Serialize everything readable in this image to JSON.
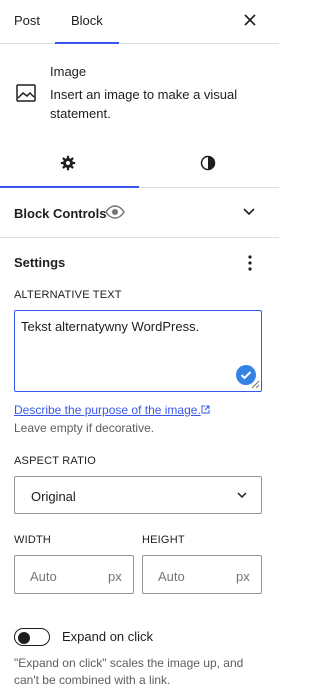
{
  "tabs": {
    "post_label": "Post",
    "block_label": "Block",
    "active": "Block"
  },
  "block_card": {
    "icon": "image-icon",
    "title": "Image",
    "description": "Insert an image to make a visual statement."
  },
  "subtabs": {
    "settings_icon": "gear-icon",
    "styles_icon": "contrast-icon",
    "active": "settings"
  },
  "block_controls": {
    "label": "Block Controls",
    "icon": "eye-icon"
  },
  "settings": {
    "title": "Settings",
    "alt_text": {
      "label": "ALTERNATIVE TEXT",
      "value": "Tekst alternatywny WordPress."
    },
    "describe_link": "Describe the purpose of the image.",
    "help": "Leave empty if decorative.",
    "aspect_ratio": {
      "label": "ASPECT RATIO",
      "selected": "Original"
    },
    "width": {
      "label": "WIDTH",
      "placeholder": "Auto",
      "unit": "px"
    },
    "height": {
      "label": "HEIGHT",
      "placeholder": "Auto",
      "unit": "px"
    },
    "expand": {
      "label": "Expand on click",
      "help": "\"Expand on click\" scales the image up, and can't be combined with a link.",
      "enabled": false
    }
  },
  "colors": {
    "accent": "#3858e9",
    "check": "#3582e6",
    "border": "#949494",
    "muted_text": "#5e5e5e"
  }
}
